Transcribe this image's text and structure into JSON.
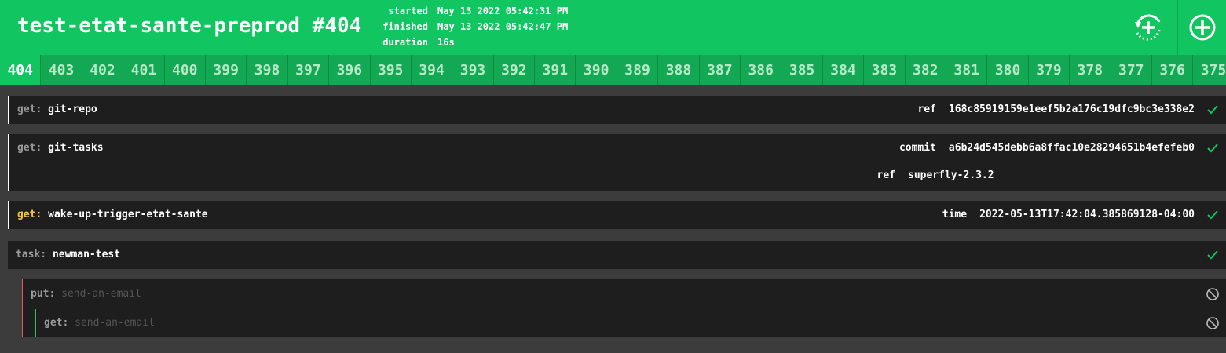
{
  "header": {
    "title": "test-etat-sante-preprod #404",
    "times": [
      {
        "label": "started",
        "value": "May 13 2022 05:42:31 PM"
      },
      {
        "label": "finished",
        "value": "May 13 2022 05:42:47 PM"
      },
      {
        "label": "duration",
        "value": "16s"
      }
    ],
    "rerun_icon": "rerun-icon",
    "trigger_icon": "plus-circle-icon",
    "colors": {
      "success": "#11c560",
      "pending": "#f5c341",
      "aborted": "#e05a5a"
    }
  },
  "builds": [
    "404",
    "403",
    "402",
    "401",
    "400",
    "399",
    "398",
    "397",
    "396",
    "395",
    "394",
    "393",
    "392",
    "391",
    "390",
    "389",
    "388",
    "387",
    "386",
    "385",
    "384",
    "383",
    "382",
    "381",
    "380",
    "379",
    "378",
    "377",
    "376",
    "375"
  ],
  "steps": [
    {
      "type": "get:",
      "name": "git-repo",
      "kv": [
        {
          "k": "ref",
          "v": "168c85919159e1eef5b2a176c19dfc9bc3e338e2"
        }
      ],
      "status": "succeeded"
    },
    {
      "type": "get:",
      "name": "git-tasks",
      "kv": [
        {
          "k": "commit",
          "v": "a6b24d545debb6a8ffac10e28294651b4efefeb0"
        },
        {
          "k": "ref",
          "v": "superfly-2.3.2"
        }
      ],
      "status": "succeeded"
    },
    {
      "type": "get:",
      "name": "wake-up-trigger-etat-sante",
      "kv": [
        {
          "k": "time",
          "v": "2022-05-13T17:42:04.385869128-04:00"
        }
      ],
      "status": "succeeded"
    },
    {
      "type": "task:",
      "name": "newman-test",
      "kv": [],
      "status": "succeeded"
    },
    {
      "type": "put:",
      "name": "send-an-email",
      "kv": [],
      "status": "skipped"
    },
    {
      "type": "get:",
      "name": "send-an-email",
      "kv": [],
      "status": "skipped"
    }
  ]
}
